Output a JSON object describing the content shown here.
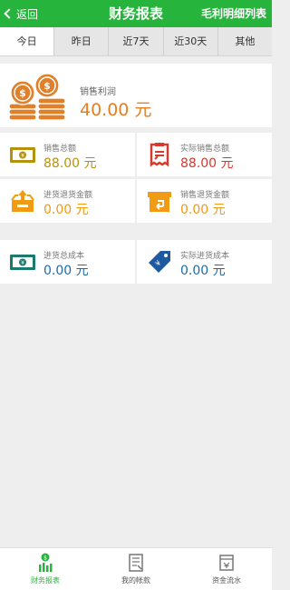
{
  "header": {
    "back_label": "返回",
    "title": "财务报表",
    "right_link": "毛利明细列表"
  },
  "tabs": [
    {
      "label": "今日",
      "active": true
    },
    {
      "label": "昨日"
    },
    {
      "label": "近7天"
    },
    {
      "label": "近30天"
    },
    {
      "label": "其他"
    }
  ],
  "profit": {
    "label": "销售利润",
    "value": "40.00 元",
    "icon": "coins-icon"
  },
  "stats": {
    "sales_total": {
      "label": "销售总额",
      "value": "88.00 元",
      "icon": "banknote-icon"
    },
    "actual_sales_total": {
      "label": "实际销售总额",
      "value": "88.00 元",
      "icon": "receipt-icon"
    },
    "purchase_return": {
      "label": "进货退货金额",
      "value": "0.00 元",
      "icon": "box-upload-icon"
    },
    "sales_return": {
      "label": "销售退货金额",
      "value": "0.00 元",
      "icon": "return-box-icon"
    },
    "purchase_cost": {
      "label": "进货总成本",
      "value": "0.00 元",
      "icon": "banknote-icon"
    },
    "actual_purchase_cost": {
      "label": "实际进货成本",
      "value": "0.00 元",
      "icon": "price-tag-icon"
    }
  },
  "bottom_nav": [
    {
      "label": "财务报表",
      "active": true,
      "icon": "report-icon"
    },
    {
      "label": "我的帐款",
      "icon": "ledger-icon"
    },
    {
      "label": "资金流水",
      "icon": "cashflow-icon"
    }
  ],
  "colors": {
    "brand_green": "#27b43d",
    "profit_orange": "#e67e22",
    "gold": "#b5920d",
    "red": "#d43a2e",
    "orange": "#f19a13",
    "blue": "#1e6aa8"
  }
}
